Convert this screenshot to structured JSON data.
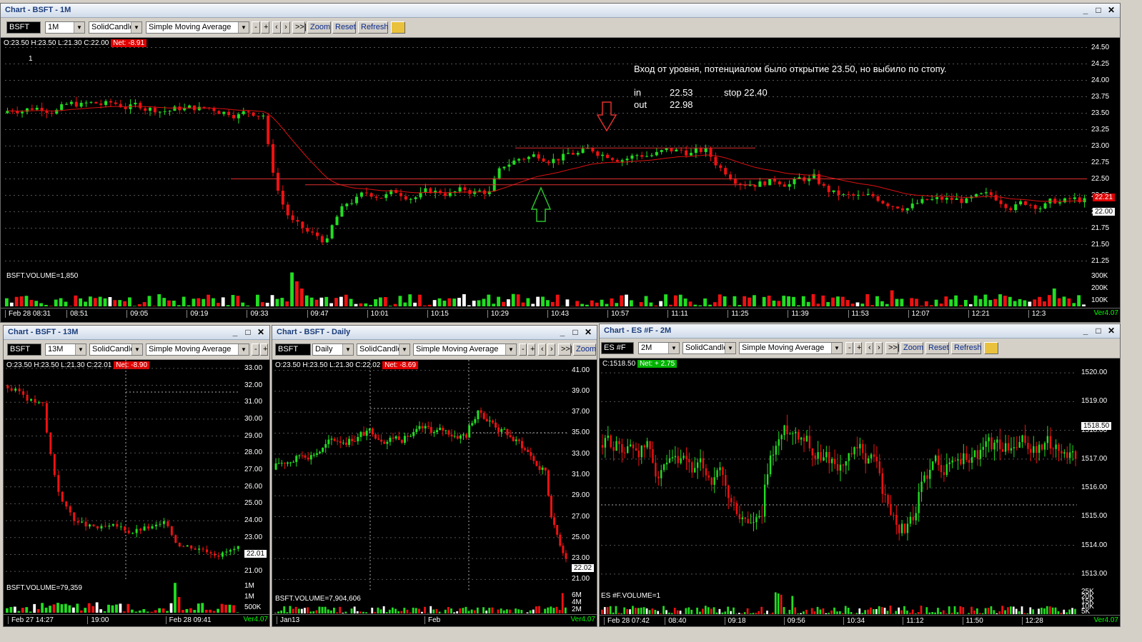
{
  "colors": {
    "up": "#22dd22",
    "down": "#ee1111",
    "sma": "#d11",
    "level": "#e03030",
    "grid": "#555"
  },
  "windows": {
    "main": {
      "title": "Chart - BSFT - 1M",
      "symbol": "BSFT",
      "interval": "1M",
      "style": "SolidCandle",
      "study": "Simple Moving Average",
      "buttons": [
        "-",
        "+",
        "‹",
        "›",
        ">>|",
        "Zoom",
        "Reset",
        "Refresh"
      ],
      "ohlc": "O:23.50  H:23.50  L:21.30  C:22.00",
      "net": "Net: -8.91",
      "volume_label": "BSFT.VOLUME=1,850",
      "price_ticks": [
        "24.50",
        "24.25",
        "24.00",
        "23.75",
        "23.50",
        "23.25",
        "23.00",
        "22.75",
        "22.50",
        "22.25",
        "22.00",
        "21.75",
        "21.50",
        "21.25"
      ],
      "volume_ticks": [
        "300K",
        "200K",
        "100K"
      ],
      "price_tag_red": "22.21",
      "price_tag_white": "22.00",
      "time_ticks": [
        "Feb 28 08:31",
        "08:51",
        "09:05",
        "09:19",
        "09:33",
        "09:47",
        "10:01",
        "10:15",
        "10:29",
        "10:43",
        "10:57",
        "11:11",
        "11:25",
        "11:39",
        "11:53",
        "12:07",
        "12:21",
        "12:3"
      ],
      "version": "Ver4.07",
      "annotation_line1": "Вход от уровня, потенциалом было открытие 23.50, но выбило по стопу.",
      "annotation_in_label": "in",
      "annotation_in_value": "22.53",
      "annotation_stop": "stop  22.40",
      "annotation_out_label": "out",
      "annotation_out_value": "22.98",
      "marker_one": "1"
    },
    "w13": {
      "title": "Chart - BSFT - 13M",
      "symbol": "BSFT",
      "interval": "13M",
      "style": "SolidCandle",
      "study": "Simple Moving Average",
      "buttons": [
        "-",
        "+"
      ],
      "ohlc": "O:23.50  H:23.50  L:21.30  C:22.01",
      "net": "Net: -8.90",
      "volume_label": "BSFT.VOLUME=79,359",
      "price_ticks": [
        "33.00",
        "32.00",
        "31.00",
        "30.00",
        "29.00",
        "28.00",
        "27.00",
        "26.00",
        "25.00",
        "24.00",
        "23.00",
        "22.00",
        "21.00"
      ],
      "volume_ticks": [
        "1M",
        "1M",
        "500K"
      ],
      "price_tag_white": "22.01",
      "time_ticks": [
        "Feb 27 14:27",
        "19:00",
        "Feb 28 09:41"
      ],
      "version": "Ver4.07"
    },
    "daily": {
      "title": "Chart - BSFT - Daily",
      "symbol": "BSFT",
      "interval": "Daily",
      "style": "SolidCandle",
      "study": "Simple Moving Average",
      "buttons": [
        "-",
        "+",
        "‹",
        "›",
        ">>|",
        "Zoom"
      ],
      "ohlc": "O:23.50  H:23.50  L:21.30  C:22.02",
      "net": "Net: -8.69",
      "volume_label": "BSFT.VOLUME=7,904,606",
      "price_ticks": [
        "41.00",
        "39.00",
        "37.00",
        "35.00",
        "33.00",
        "31.00",
        "29.00",
        "27.00",
        "25.00",
        "23.00",
        "21.00"
      ],
      "volume_ticks": [
        "6M",
        "4M",
        "2M"
      ],
      "price_tag_white": "22.02",
      "time_ticks": [
        "Jan13",
        "Feb"
      ],
      "version": "Ver4.07"
    },
    "es": {
      "title": "Chart - ES #F - 2M",
      "symbol": "ES #F",
      "interval": "2M",
      "style": "SolidCandle",
      "study": "Simple Moving Average",
      "buttons": [
        "-",
        "+",
        "‹",
        "›",
        ">>|",
        "Zoom",
        "Reset",
        "Refresh"
      ],
      "ohlc": "C:1518.50",
      "net": "Net: + 2.75",
      "volume_label": "ES #F.VOLUME=1",
      "price_ticks": [
        "1520.00",
        "1519.00",
        "1518.00",
        "1517.00",
        "1516.00",
        "1515.00",
        "1514.00",
        "1513.00"
      ],
      "volume_ticks": [
        "25K",
        "20K",
        "15K",
        "10K",
        "5K"
      ],
      "price_tag_white": "1518.50",
      "time_ticks": [
        "Feb 28 07:42",
        "08:40",
        "09:18",
        "09:56",
        "10:34",
        "11:12",
        "11:50",
        "12:28"
      ],
      "version": "Ver4.07"
    }
  }
}
